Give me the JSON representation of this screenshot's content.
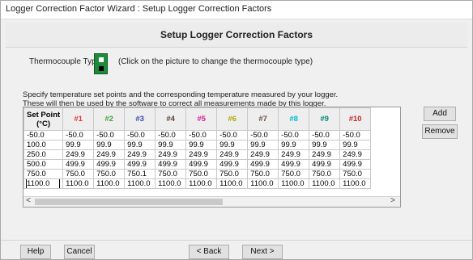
{
  "window": {
    "title": "Logger Correction Factor Wizard : Setup Logger Correction Factors"
  },
  "header": {
    "title": "Setup Logger Correction Factors"
  },
  "thermocouple": {
    "label": "Thermocouple Type:",
    "hint": "(Click on the picture to change the thermocouple type)",
    "icon": "thermocouple-connector-icon"
  },
  "instructions": {
    "line1": "Specify temperature set points and the corresponding temperature measured by your logger.",
    "line2": "These will then be used by the software to correct all measurements made by this logger."
  },
  "table": {
    "set_point_header_line1": "Set Point",
    "set_point_header_line2": "(°C)",
    "columns": [
      {
        "label": "#1",
        "color": "#e53935"
      },
      {
        "label": "#2",
        "color": "#43a047"
      },
      {
        "label": "#3",
        "color": "#3949ab"
      },
      {
        "label": "#4",
        "color": "#5d4037"
      },
      {
        "label": "#5",
        "color": "#d81b9c"
      },
      {
        "label": "#6",
        "color": "#b5a600"
      },
      {
        "label": "#7",
        "color": "#6d4c41"
      },
      {
        "label": "#8",
        "color": "#00bcd4"
      },
      {
        "label": "#9",
        "color": "#00897b"
      },
      {
        "label": "#10",
        "color": "#c62828"
      }
    ],
    "rows": [
      [
        "-50.0",
        "-50.0",
        "-50.0",
        "-50.0",
        "-50.0",
        "-50.0",
        "-50.0",
        "-50.0",
        "-50.0",
        "-50.0",
        "-50.0"
      ],
      [
        "100.0",
        "99.9",
        "99.9",
        "99.9",
        "99.9",
        "99.9",
        "99.9",
        "99.9",
        "99.9",
        "99.9",
        "99.9"
      ],
      [
        "250.0",
        "249.9",
        "249.9",
        "249.9",
        "249.9",
        "249.9",
        "249.9",
        "249.9",
        "249.9",
        "249.9",
        "249.9"
      ],
      [
        "500.0",
        "499.9",
        "499.9",
        "499.9",
        "499.9",
        "499.9",
        "499.9",
        "499.9",
        "499.9",
        "499.9",
        "499.9"
      ],
      [
        "750.0",
        "750.0",
        "750.0",
        "750.1",
        "750.0",
        "750.0",
        "750.0",
        "750.0",
        "750.0",
        "750.0",
        "750.0"
      ],
      [
        "1100.0",
        "1100.0",
        "1100.0",
        "1100.0",
        "1100.0",
        "1100.0",
        "1100.0",
        "1100.0",
        "1100.0",
        "1100.0",
        "1100.0"
      ]
    ],
    "selected_row": 5
  },
  "buttons": {
    "add": "Add",
    "remove": "Remove",
    "help": "Help",
    "cancel": "Cancel",
    "back": "< Back",
    "next": "Next >"
  },
  "scrollbar": {
    "left_arrow": "<",
    "right_arrow": ">"
  }
}
